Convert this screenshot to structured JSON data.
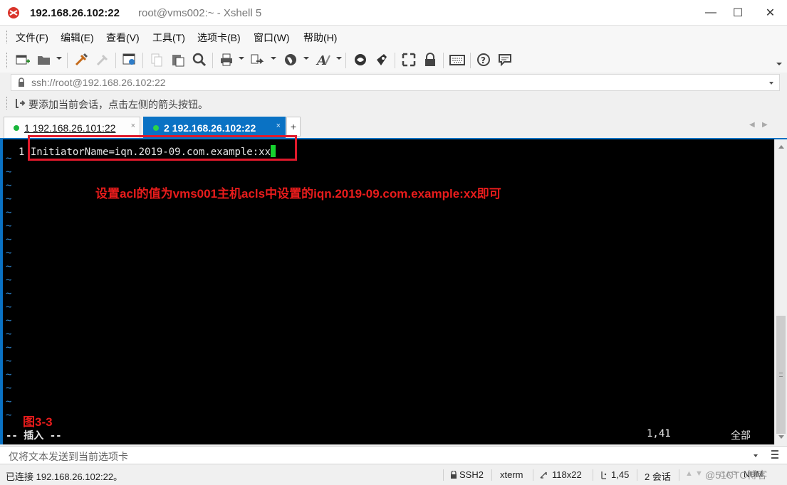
{
  "window": {
    "title_host": "192.168.26.102:22",
    "title_rest": "root@vms002:~ - Xshell 5",
    "minimize_glyph": "—",
    "maximize_glyph": "☐",
    "close_glyph": "✕"
  },
  "menu": {
    "items": [
      "文件(F)",
      "编辑(E)",
      "查看(V)",
      "工具(T)",
      "选项卡(B)",
      "窗口(W)",
      "帮助(H)"
    ]
  },
  "toolbar": {
    "icons": [
      "new-session-icon",
      "open-folder-icon",
      "reconnect-icon",
      "disconnect-icon",
      "properties-icon",
      "copy-icon",
      "paste-icon",
      "find-icon",
      "print-icon",
      "transfer-icon",
      "globe-icon",
      "font-icon",
      "xftp-icon",
      "xmanager-icon",
      "fullscreen-icon",
      "lock-icon",
      "keyboard-icon",
      "help-icon",
      "chat-icon"
    ]
  },
  "address": {
    "value": "ssh://root@192.168.26.102:22"
  },
  "hint": {
    "text": "要添加当前会话，点击左侧的箭头按钮。"
  },
  "tabs": [
    {
      "label": "1 192.168.26.101:22",
      "close": "×"
    },
    {
      "label": "2 192.168.26.102:22",
      "close": "×"
    }
  ],
  "tab_add": "+",
  "tab_nav": {
    "prev": "◀",
    "next": "▶"
  },
  "terminal": {
    "line_number": "1",
    "line_text": "InitiatorName=iqn.2019-09.com.example:xx",
    "tilde": "~",
    "annotation": "设置acl的值为vms001主机acls中设置的iqn.2019-09.com.example:xx即可",
    "figure_label": "图3-3",
    "mode": "-- 插入 --",
    "position": "1,41",
    "scope": "全部"
  },
  "compose": {
    "placeholder": "仅将文本发送到当前选项卡"
  },
  "status": {
    "connected": "已连接 192.168.26.102:22。",
    "protocol": "SSH2",
    "terminal_type": "xterm",
    "size": "118x22",
    "cursor": "1,45",
    "sessions": "2 会话",
    "caps": "CAP",
    "num": "NUM",
    "watermark": "@51CTO博客"
  },
  "colors": {
    "tab_active": "#0a72c4",
    "annotation": "#e81c1c",
    "cursor": "#16d12e",
    "tilde": "#2f8ad6"
  }
}
